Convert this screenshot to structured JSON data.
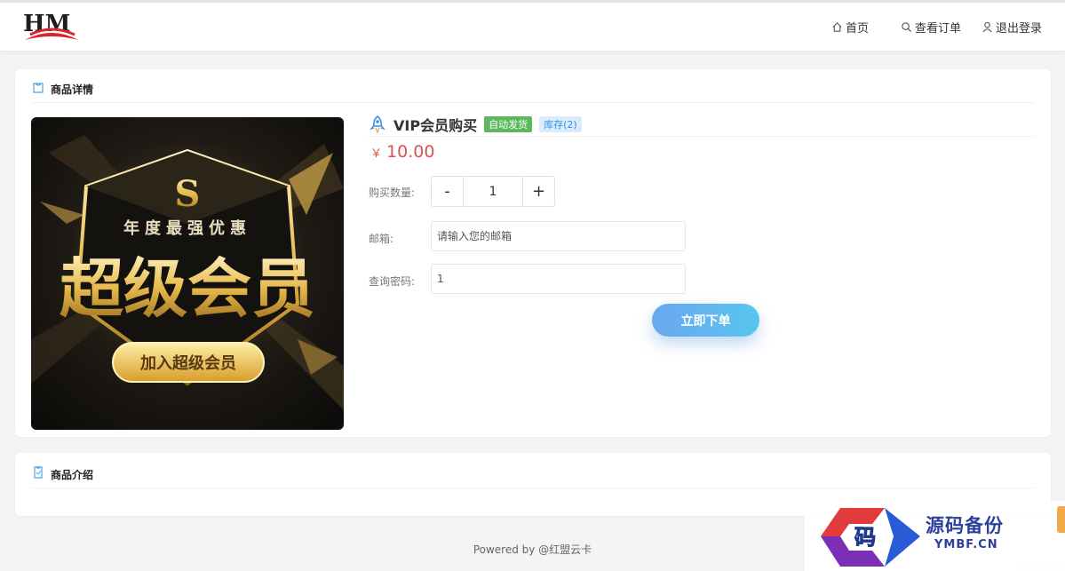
{
  "header": {
    "logo_text": "HM",
    "nav": [
      {
        "label": "首页",
        "icon": "home-icon"
      },
      {
        "label": "查看订单",
        "icon": "search-icon"
      },
      {
        "label": "退出登录",
        "icon": "user-icon"
      }
    ]
  },
  "detail_card": {
    "title": "商品详情",
    "icon": "shopping-bag-icon",
    "product": {
      "name": "VIP会员购买",
      "badge_auto": "自动发货",
      "badge_stock": "库存(2)",
      "currency": "￥",
      "price": "10.00",
      "image": {
        "top_text": "年度最强优惠",
        "main_text": "超级会员",
        "button_text": "加入超级会员",
        "emblem": "S"
      }
    },
    "form": {
      "quantity_label": "购买数量:",
      "quantity_minus": "-",
      "quantity_value": "1",
      "quantity_plus": "+",
      "email_label": "邮箱:",
      "email_placeholder": "请输入您的邮箱",
      "password_label": "查询密码:",
      "password_value": "1",
      "submit_label": "立即下单"
    }
  },
  "intro_card": {
    "title": "商品介绍",
    "icon": "tag-icon"
  },
  "footer": {
    "text": "Powered by @红盟云卡"
  },
  "watermark": {
    "title": "源码备份",
    "subtitle": "YMBF.CN",
    "glyph": "码"
  },
  "colors": {
    "price": "#d9534f",
    "badge_auto": "#5cb85c",
    "badge_stock": "#3a8ee6",
    "accent_blue": "#4aa3df"
  }
}
